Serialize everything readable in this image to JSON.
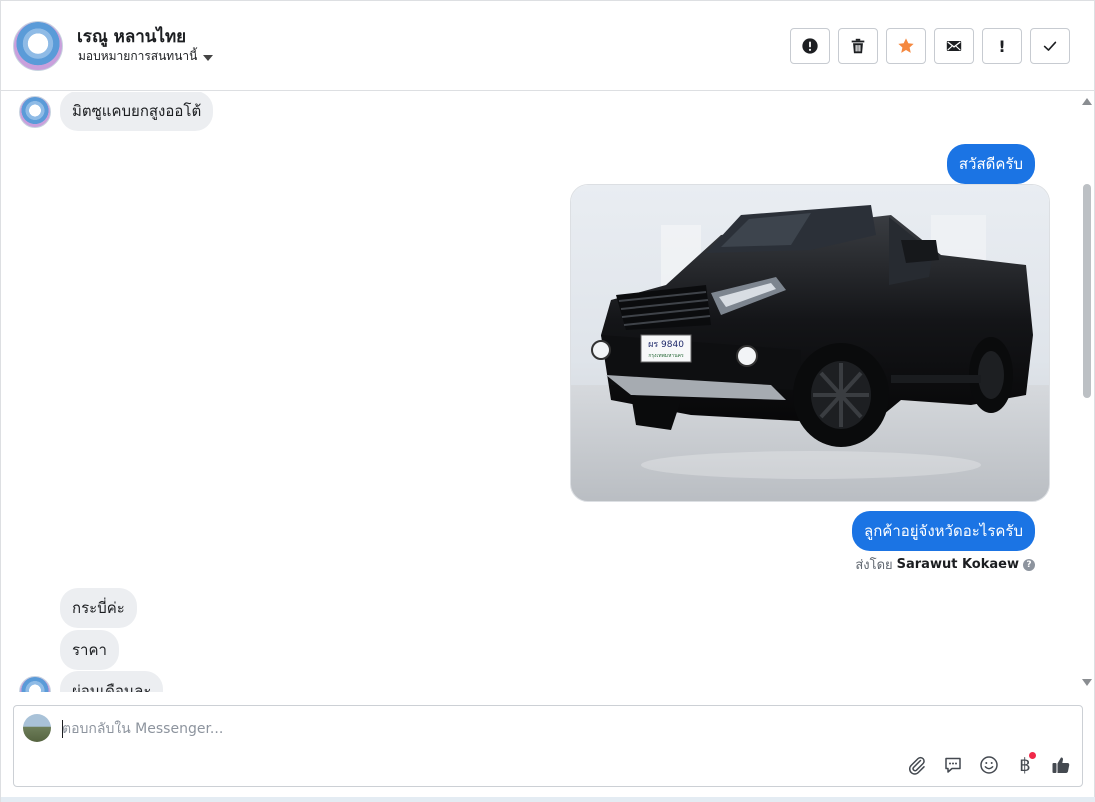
{
  "header": {
    "contact_name": "เรณู หลานไทย",
    "assign_label": "มอบหมายการสนทนานี้",
    "toolbar": [
      {
        "name": "report-spam-button",
        "icon": "alert-circle-icon"
      },
      {
        "name": "delete-button",
        "icon": "trash-icon"
      },
      {
        "name": "star-button",
        "icon": "star-icon"
      },
      {
        "name": "mark-unread-button",
        "icon": "envelope-icon"
      },
      {
        "name": "follow-up-button",
        "icon": "exclamation-icon",
        "label": "!"
      },
      {
        "name": "mark-done-button",
        "icon": "check-icon"
      }
    ],
    "star_color": "#f5883f"
  },
  "messages": {
    "in_1": "มิตซูแคบยกสูงออโต้",
    "out_1": "สวัสดีครับ",
    "out_2": "ลูกค้าอยู่จังหวัดอะไรครับ",
    "sent_by_prefix": "ส่งโดย",
    "sent_by_name": "Sarawut Kokaew",
    "in_2": "กระบี่ค่ะ",
    "in_3": "ราคา",
    "in_4": "ผ่อนเดือนละ",
    "photo_plate": "ผร 9840",
    "photo_plate_sub": "กรุงเทพมหานคร",
    "bubble_out_color": "#1b74e4",
    "bubble_in_color": "#eceef1"
  },
  "composer": {
    "placeholder": "ตอบกลับใน Messenger...",
    "value": "",
    "tools": [
      "paperclip-icon",
      "saved-replies-icon",
      "emoji-icon",
      "baht-payment-icon",
      "thumbs-up-icon"
    ],
    "baht_symbol": "฿",
    "like_color": "#444950"
  }
}
